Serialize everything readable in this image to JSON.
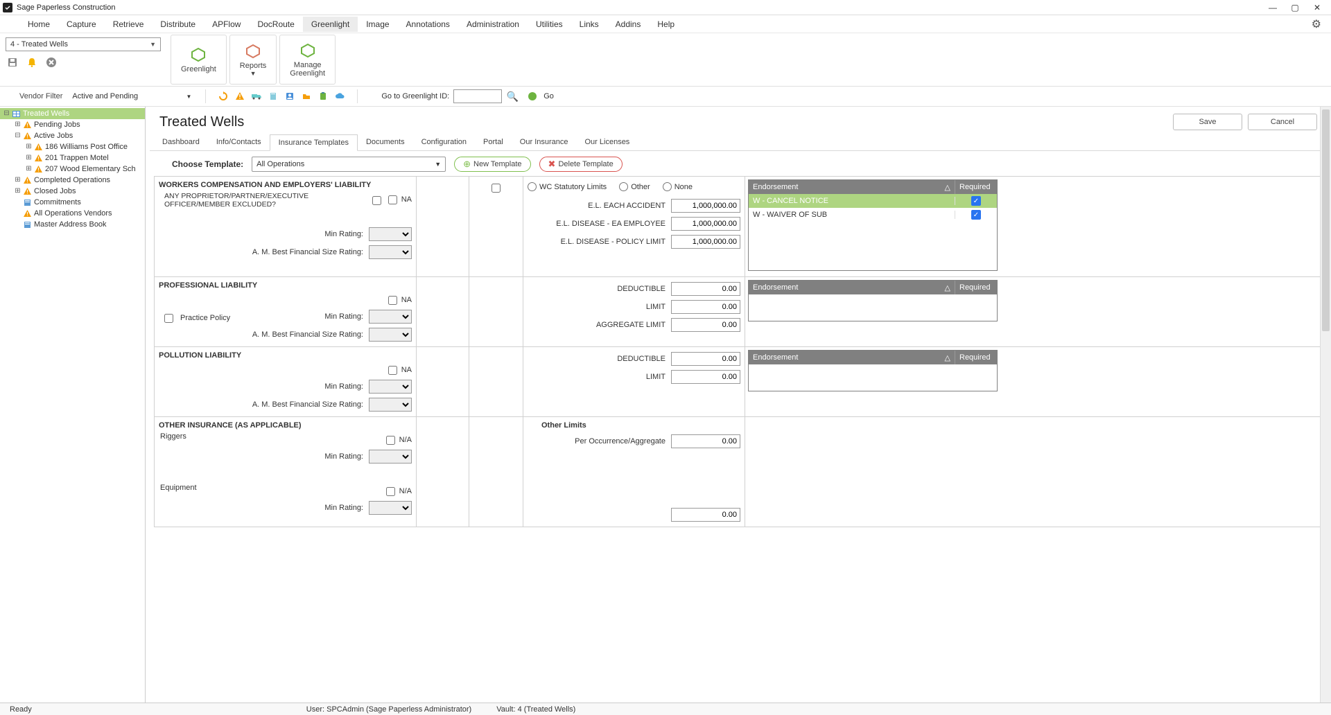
{
  "window": {
    "title": "Sage Paperless Construction"
  },
  "menubar": [
    "Home",
    "Capture",
    "Retrieve",
    "Distribute",
    "APFlow",
    "DocRoute",
    "Greenlight",
    "Image",
    "Annotations",
    "Administration",
    "Utilities",
    "Links",
    "Addins",
    "Help"
  ],
  "menubar_active": "Greenlight",
  "ribbon_left": {
    "combo_value": "4 - Treated Wells"
  },
  "ribbon": [
    {
      "label": "Greenlight",
      "color": "#6db33f"
    },
    {
      "label": "Reports",
      "arrow": true,
      "color": "#d77a61"
    },
    {
      "label": "Manage\nGreenlight",
      "color": "#6db33f"
    }
  ],
  "toolbar2": {
    "vendor_filter_label": "Vendor Filter",
    "vendor_filter_value": "Active and Pending",
    "go_label": "Go to Greenlight ID:",
    "go_text": "Go"
  },
  "tree": {
    "root_label": "Treated Wells",
    "nodes": [
      {
        "label": "Pending Jobs",
        "icon": "warn",
        "exp": "plus",
        "lvl": 1
      },
      {
        "label": "Active Jobs",
        "icon": "warn",
        "exp": "minus",
        "lvl": 1
      },
      {
        "label": "186  Williams Post Office",
        "icon": "warn",
        "exp": "plus",
        "lvl": 2
      },
      {
        "label": "201  Trappen Motel",
        "icon": "warn",
        "exp": "plus",
        "lvl": 2
      },
      {
        "label": "207  Wood Elementary Sch",
        "icon": "warn",
        "exp": "plus",
        "lvl": 2
      },
      {
        "label": "Completed Operations",
        "icon": "warn",
        "exp": "plus",
        "lvl": 1
      },
      {
        "label": "Closed Jobs",
        "icon": "warn",
        "exp": "plus",
        "lvl": 1
      },
      {
        "label": "Commitments",
        "icon": "doc",
        "exp": "none",
        "lvl": 1
      },
      {
        "label": "All Operations Vendors",
        "icon": "warn",
        "exp": "none",
        "lvl": 1
      },
      {
        "label": "Master Address Book",
        "icon": "doc",
        "exp": "none",
        "lvl": 1
      }
    ]
  },
  "page": {
    "title": "Treated Wells",
    "save": "Save",
    "cancel": "Cancel"
  },
  "subtabs": [
    "Dashboard",
    "Info/Contacts",
    "Insurance Templates",
    "Documents",
    "Configuration",
    "Portal",
    "Our Insurance",
    "Our Licenses"
  ],
  "subtab_active": "Insurance Templates",
  "choose": {
    "label": "Choose Template:",
    "value": "All Operations",
    "new_btn": "New Template",
    "del_btn": "Delete Template"
  },
  "sections": {
    "workers": {
      "title": "WORKERS COMPENSATION AND EMPLOYERS' LIABILITY",
      "question": "ANY PROPRIETOR/PARTNER/EXECUTIVE\nOFFICER/MEMBER EXCLUDED?",
      "na": "NA",
      "min_rating": "Min Rating:",
      "am_best": "A. M. Best Financial Size Rating:",
      "radios": {
        "wc": "WC Statutory Limits",
        "other": "Other",
        "none": "None"
      },
      "amounts": [
        {
          "label": "E.L. EACH ACCIDENT",
          "value": "1,000,000.00"
        },
        {
          "label": "E.L. DISEASE - EA EMPLOYEE",
          "value": "1,000,000.00"
        },
        {
          "label": "E.L. DISEASE - POLICY LIMIT",
          "value": "1,000,000.00"
        }
      ],
      "endorsements": [
        {
          "label": "W - CANCEL NOTICE",
          "req": true,
          "sel": true
        },
        {
          "label": "W - WAIVER OF SUB",
          "req": true,
          "sel": false
        }
      ]
    },
    "prof": {
      "title": "PROFESSIONAL LIABILITY",
      "practice": "Practice Policy",
      "na": "NA",
      "min_rating": "Min Rating:",
      "am_best": "A. M. Best Financial Size Rating:",
      "amounts": [
        {
          "label": "DEDUCTIBLE",
          "value": "0.00"
        },
        {
          "label": "LIMIT",
          "value": "0.00"
        },
        {
          "label": "AGGREGATE LIMIT",
          "value": "0.00"
        }
      ]
    },
    "poll": {
      "title": "POLLUTION LIABILITY",
      "na": "NA",
      "min_rating": "Min Rating:",
      "am_best": "A. M. Best Financial Size Rating:",
      "amounts": [
        {
          "label": "DEDUCTIBLE",
          "value": "0.00"
        },
        {
          "label": "LIMIT",
          "value": "0.00"
        }
      ]
    },
    "other": {
      "title": "OTHER INSURANCE (AS APPLICABLE)",
      "rigger_label": "Riggers",
      "na": "N/A",
      "min_rating": "Min  Rating:",
      "equip_label": "Equipment",
      "other_limits_title": "Other Limits",
      "per_occ": "Per Occurrence/Aggregate",
      "per_occ_val": "0.00",
      "equip_val": "0.00"
    }
  },
  "endorse_header": {
    "c1": "Endorsement",
    "c2": "Required",
    "sort": "△"
  },
  "statusbar": {
    "ready": "Ready",
    "user": "User: SPCAdmin (Sage Paperless Administrator)",
    "vault": "Vault: 4 (Treated Wells)"
  }
}
